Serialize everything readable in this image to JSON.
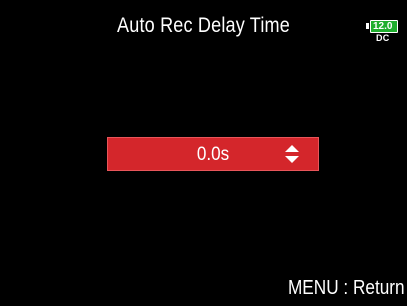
{
  "header": {
    "title": "Auto Rec Delay Time"
  },
  "status": {
    "battery_value": "12.0",
    "power_source": "DC",
    "battery_color": "#1fae2e"
  },
  "setting": {
    "value": "0.0s",
    "highlight_color": "#d4262b",
    "icon": "up-down-arrows-icon"
  },
  "footer": {
    "menu_hint": "MENU : Return"
  }
}
